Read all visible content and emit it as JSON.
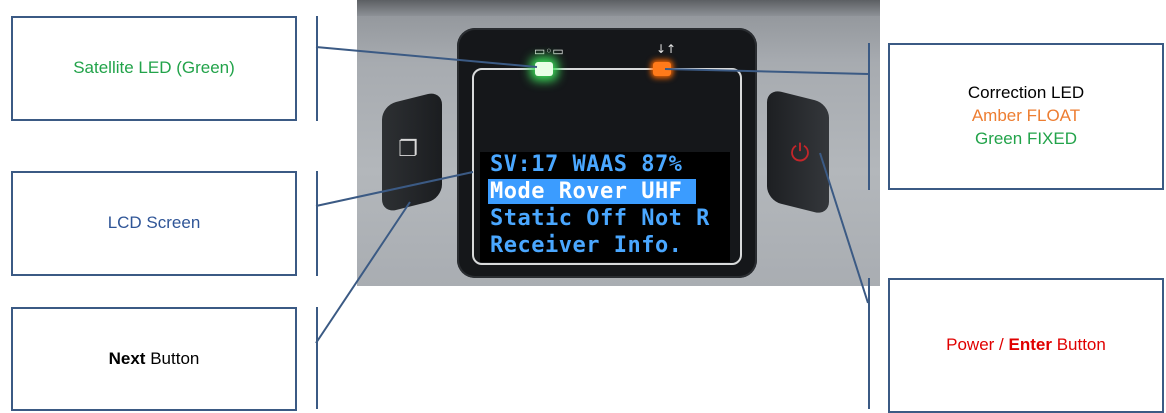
{
  "callouts": {
    "satellite": {
      "text": "Satellite LED (Green)",
      "color": "#22a34a"
    },
    "lcd": {
      "text": "LCD Screen",
      "color": "#2f5597"
    },
    "next": {
      "bold": "Next",
      "rest": " Button",
      "color": "#000000"
    },
    "correction": {
      "line1": "Correction LED",
      "line2": "Amber FLOAT",
      "line3": "Green FIXED",
      "color1": "#000000",
      "color2": "#ed7d31",
      "color3": "#22a34a"
    },
    "power": {
      "part1": "Power / ",
      "bold": "Enter",
      "part2": " Button",
      "color": "#e00000"
    }
  },
  "lcd_screen": {
    "lines": [
      "SV:17 WAAS 87%",
      "Mode Rover UHF",
      "Static Off Not R",
      "Receiver Info."
    ],
    "highlighted_line": 2,
    "text_color": "#4aa7ff",
    "highlight_color": "#3b9cff"
  },
  "leds": {
    "satellite": {
      "state_color": "#3ddc5a",
      "icon": "satellite-icon"
    },
    "correction": {
      "state_color": "#ff7a1a",
      "icon": "up-down-arrows-icon"
    }
  },
  "buttons": {
    "next": {
      "icon": "pages-icon"
    },
    "power": {
      "icon": "power-icon",
      "color": "#c4262a"
    }
  },
  "leader_color": "#3b5a84"
}
